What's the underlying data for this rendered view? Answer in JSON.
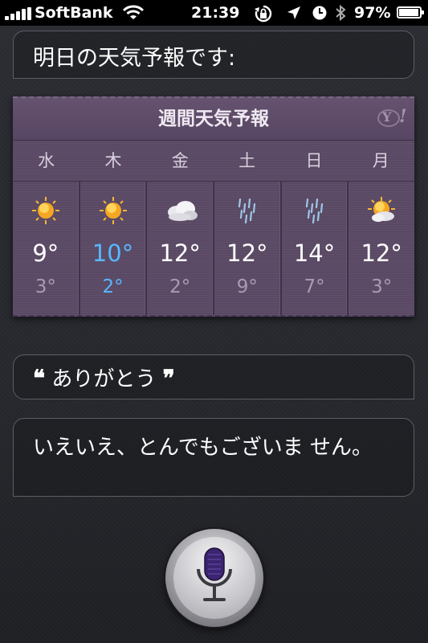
{
  "status_bar": {
    "carrier": "SoftBank",
    "time": "21:39",
    "battery_percent": "97%",
    "battery_level": 0.97,
    "icons": [
      "signal-icon",
      "wifi-icon",
      "orientation-lock-icon",
      "location-arrow-icon",
      "alarm-clock-icon",
      "bluetooth-icon",
      "battery-icon"
    ]
  },
  "siri_response": "明日の天気予報です:",
  "weather": {
    "title": "週間天気予報",
    "provider_icon": "yahoo-logo",
    "highlight_index": 1,
    "days": [
      {
        "day": "水",
        "icon": "sunny-icon",
        "high": "9°",
        "low": "3°"
      },
      {
        "day": "木",
        "icon": "sunny-icon",
        "high": "10°",
        "low": "2°"
      },
      {
        "day": "金",
        "icon": "cloudy-icon",
        "high": "12°",
        "low": "2°"
      },
      {
        "day": "土",
        "icon": "rain-icon",
        "high": "12°",
        "low": "9°"
      },
      {
        "day": "日",
        "icon": "rain-icon",
        "high": "14°",
        "low": "7°"
      },
      {
        "day": "月",
        "icon": "partly-cloudy-icon",
        "high": "12°",
        "low": "3°"
      }
    ]
  },
  "user_utterance": {
    "open_quote": "❝",
    "text": "ありがとう",
    "close_quote": "❞"
  },
  "siri_reply": "いえいえ、とんでもございま せん。",
  "mic_button": {
    "icon": "microphone-icon"
  },
  "colors": {
    "highlight": "#58b7ff",
    "card": "#5a4964",
    "mic_fill": "#3b2470"
  }
}
